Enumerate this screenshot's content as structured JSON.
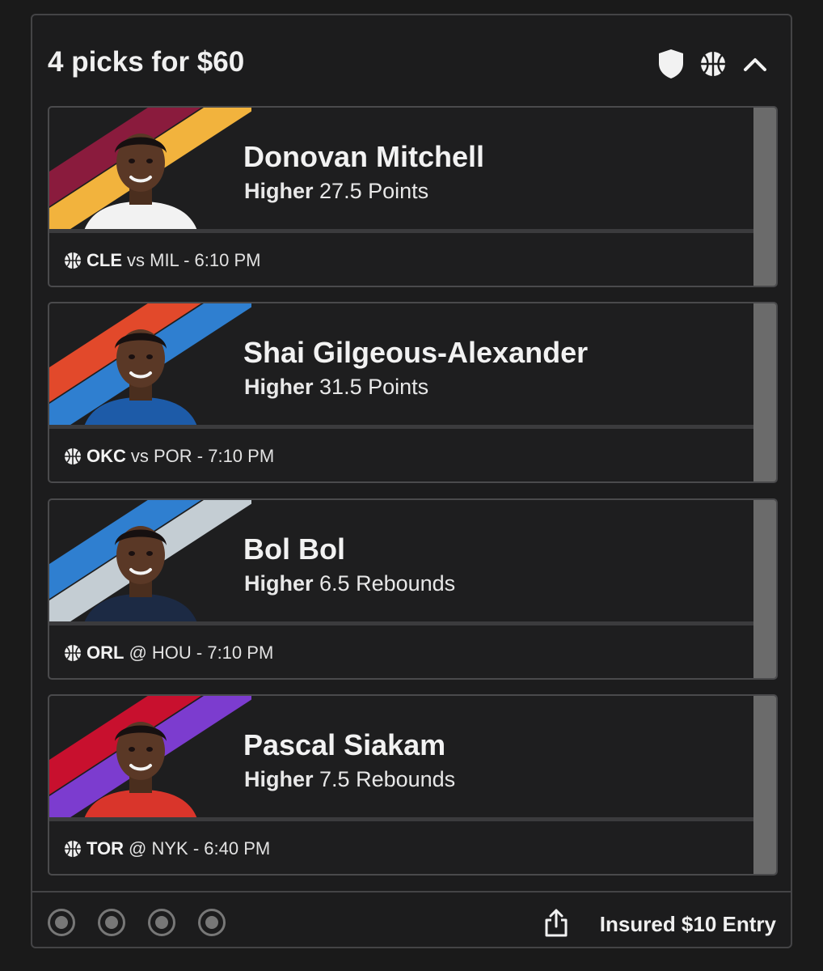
{
  "header": {
    "title": "4 picks for $60",
    "icons": [
      "shield-icon",
      "basketball-icon",
      "chevron-up-icon"
    ]
  },
  "picks": [
    {
      "player": "Donovan Mitchell",
      "direction": "Higher",
      "line": "27.5 Points",
      "team": "CLE",
      "matchup_rest": "vs MIL - 6:10 PM",
      "colors": [
        "#8a1b3d",
        "#f2b33d"
      ],
      "jersey": "#f2f2f2"
    },
    {
      "player": "Shai Gilgeous-Alexander",
      "direction": "Higher",
      "line": "31.5 Points",
      "team": "OKC",
      "matchup_rest": "vs POR - 7:10 PM",
      "colors": [
        "#e2492b",
        "#2f7fd0"
      ],
      "jersey": "#1d5ba8"
    },
    {
      "player": "Bol Bol",
      "direction": "Higher",
      "line": "6.5 Rebounds",
      "team": "ORL",
      "matchup_rest": "@ HOU - 7:10 PM",
      "colors": [
        "#2f7fd0",
        "#c4cdd3"
      ],
      "jersey": "#1c2a44"
    },
    {
      "player": "Pascal Siakam",
      "direction": "Higher",
      "line": "7.5 Rebounds",
      "team": "TOR",
      "matchup_rest": "@ NYK - 6:40 PM",
      "colors": [
        "#c8102e",
        "#7c3ccf"
      ],
      "jersey": "#d9352b"
    }
  ],
  "footer": {
    "entry_label": "Insured $10 Entry",
    "dot_count": 4
  }
}
